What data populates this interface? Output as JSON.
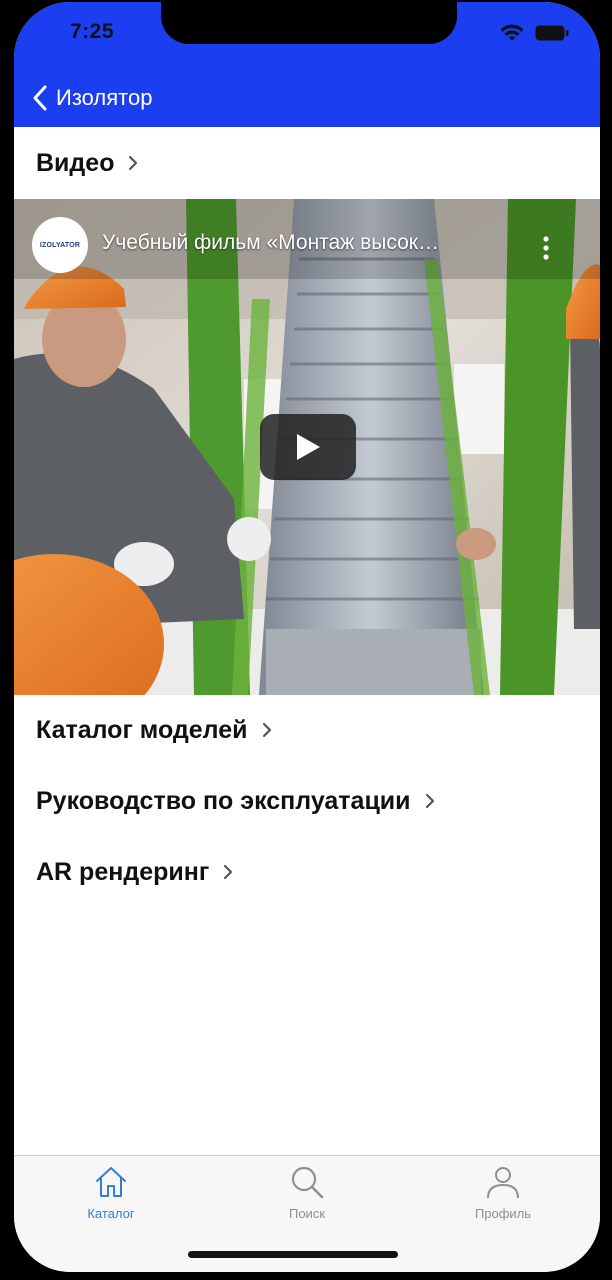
{
  "status_bar": {
    "time": "7:25"
  },
  "nav": {
    "back_label": "Изолятор"
  },
  "video_section": {
    "title": "Видео",
    "video": {
      "title": "Учебный фильм «Монтаж высок…",
      "channel_logo_text": "IZOLYATOR"
    }
  },
  "menu": {
    "items": [
      {
        "label": "Каталог моделей"
      },
      {
        "label": "Руководство по эксплуатации"
      },
      {
        "label": "AR рендеринг"
      }
    ]
  },
  "tabbar": {
    "tabs": [
      {
        "label": "Каталог",
        "icon": "home-icon",
        "active": true
      },
      {
        "label": "Поиск",
        "icon": "search-icon",
        "active": false
      },
      {
        "label": "Профиль",
        "icon": "profile-icon",
        "active": false
      }
    ],
    "active_color": "#2f7fd8",
    "inactive_color": "#8e8e93"
  },
  "colors": {
    "header": "#1a3ef0"
  }
}
